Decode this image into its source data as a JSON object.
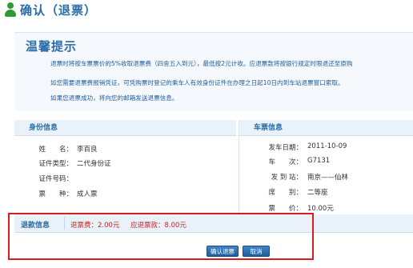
{
  "page": {
    "title": "确认（退票）"
  },
  "notice": {
    "title": "温馨提示",
    "lines": [
      "退票时将按车票票价的5%收取退票费（四舍五入到元），最低按2元计收。应退票款将按银行规定时限退还至原购",
      "如您需要退票费报销凭证，可凭购票时登记的乘车人有效身份证件在办理之日起10日内到车站退票窗口索取。",
      "如果您退票成功，将向您的邮箱发送退票信息。"
    ]
  },
  "identity": {
    "header": "身份信息",
    "fields": [
      {
        "label": "姓　　名：",
        "value": "李百良"
      },
      {
        "label": "证件类型：",
        "value": "二代身份证"
      },
      {
        "label": "证件号码：",
        "value": ""
      },
      {
        "label": "票　　种：",
        "value": "成人票"
      }
    ]
  },
  "ticket": {
    "header": "车票信息",
    "fields": [
      {
        "label": "发车日期：",
        "value": "2011-10-09"
      },
      {
        "label": "车　　次：",
        "value": "G7131"
      },
      {
        "label": "发 到 站：",
        "value": "南京——仙林"
      },
      {
        "label": "席　　别：",
        "value": "二等座"
      },
      {
        "label": "票　　价：",
        "value": "10.00元"
      }
    ]
  },
  "refund": {
    "label": "退款信息",
    "fee": "退票费：2.00元",
    "amount": "应退票款：8.00元"
  },
  "buttons": {
    "confirm": "确认退票",
    "cancel": "取消"
  },
  "colors": {
    "accent": "#2a6da8",
    "highlight_frame": "#d91c1c",
    "refund_text": "#cc2222",
    "icon": "#2f9a32"
  }
}
